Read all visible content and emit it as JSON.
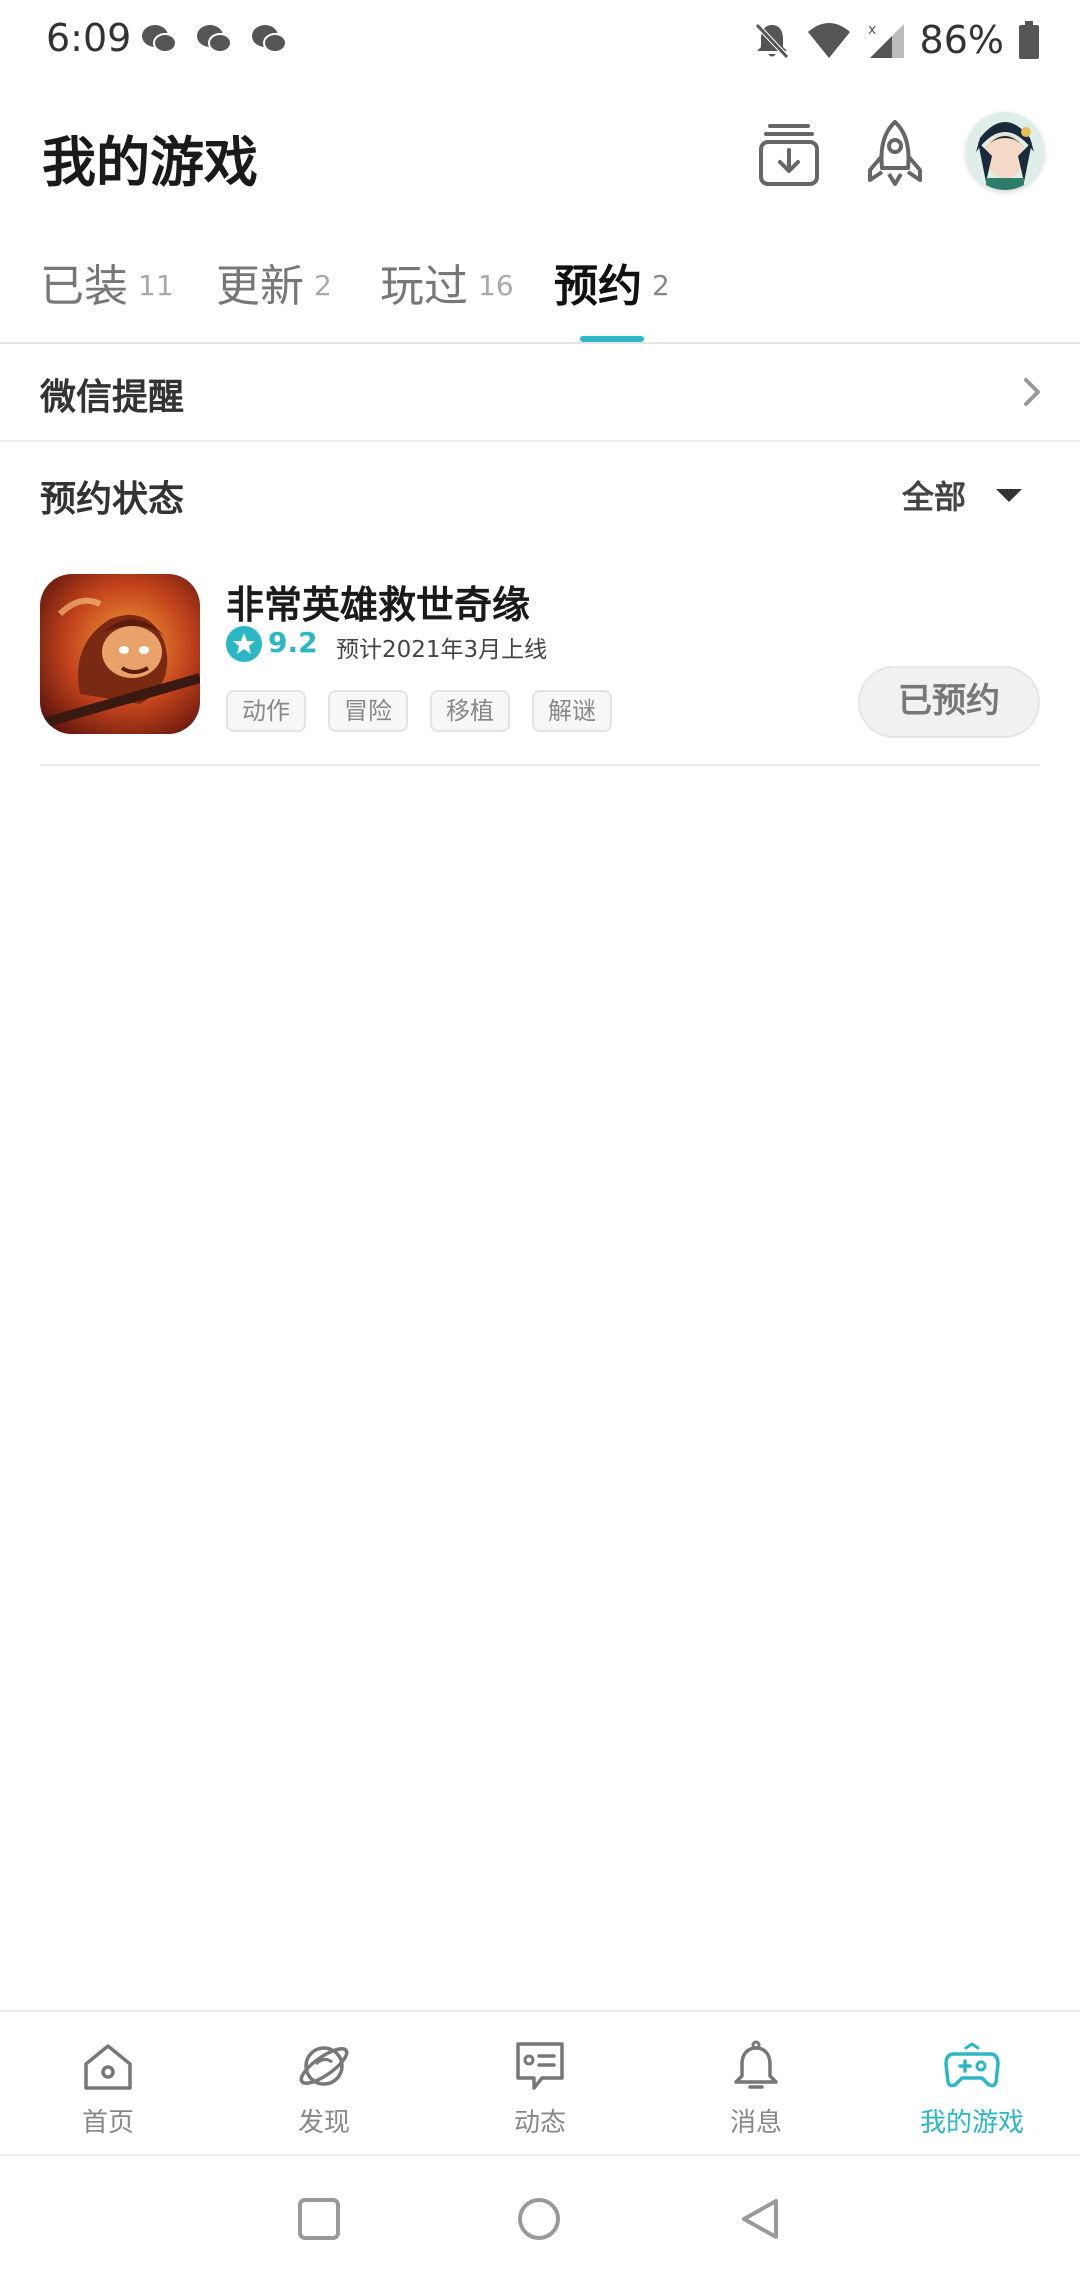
{
  "status_bar": {
    "time": "6:09",
    "battery": "86%",
    "icons": [
      "wechat-icon",
      "wechat-icon",
      "wechat-icon",
      "bell-off-icon",
      "wifi-icon",
      "signal-icon",
      "battery-icon"
    ]
  },
  "header": {
    "title": "我的游戏",
    "icons": [
      "download-manager-icon",
      "rocket-icon",
      "avatar"
    ]
  },
  "tabs": [
    {
      "label": "已装",
      "count": "11"
    },
    {
      "label": "更新",
      "count": "2"
    },
    {
      "label": "玩过",
      "count": "16"
    },
    {
      "label": "预约",
      "count": "2",
      "active": true
    }
  ],
  "wechat_reminder": {
    "label": "微信提醒"
  },
  "reservation": {
    "status_label": "预约状态",
    "filter_label": "全部"
  },
  "games": [
    {
      "title": "非常英雄救世奇缘",
      "rating": "9.2",
      "release": "预计2021年3月上线",
      "tags": [
        "动作",
        "冒险",
        "移植",
        "解谜"
      ],
      "button": "已预约"
    }
  ],
  "bottom_nav": [
    {
      "label": "首页",
      "icon": "home-icon"
    },
    {
      "label": "发现",
      "icon": "planet-icon"
    },
    {
      "label": "动态",
      "icon": "feed-icon"
    },
    {
      "label": "消息",
      "icon": "bell-icon"
    },
    {
      "label": "我的游戏",
      "icon": "gamepad-icon",
      "active": true
    }
  ],
  "colors": {
    "accent": "#2bb7c4",
    "text_primary": "#1a1a1a",
    "text_secondary": "#888888"
  }
}
